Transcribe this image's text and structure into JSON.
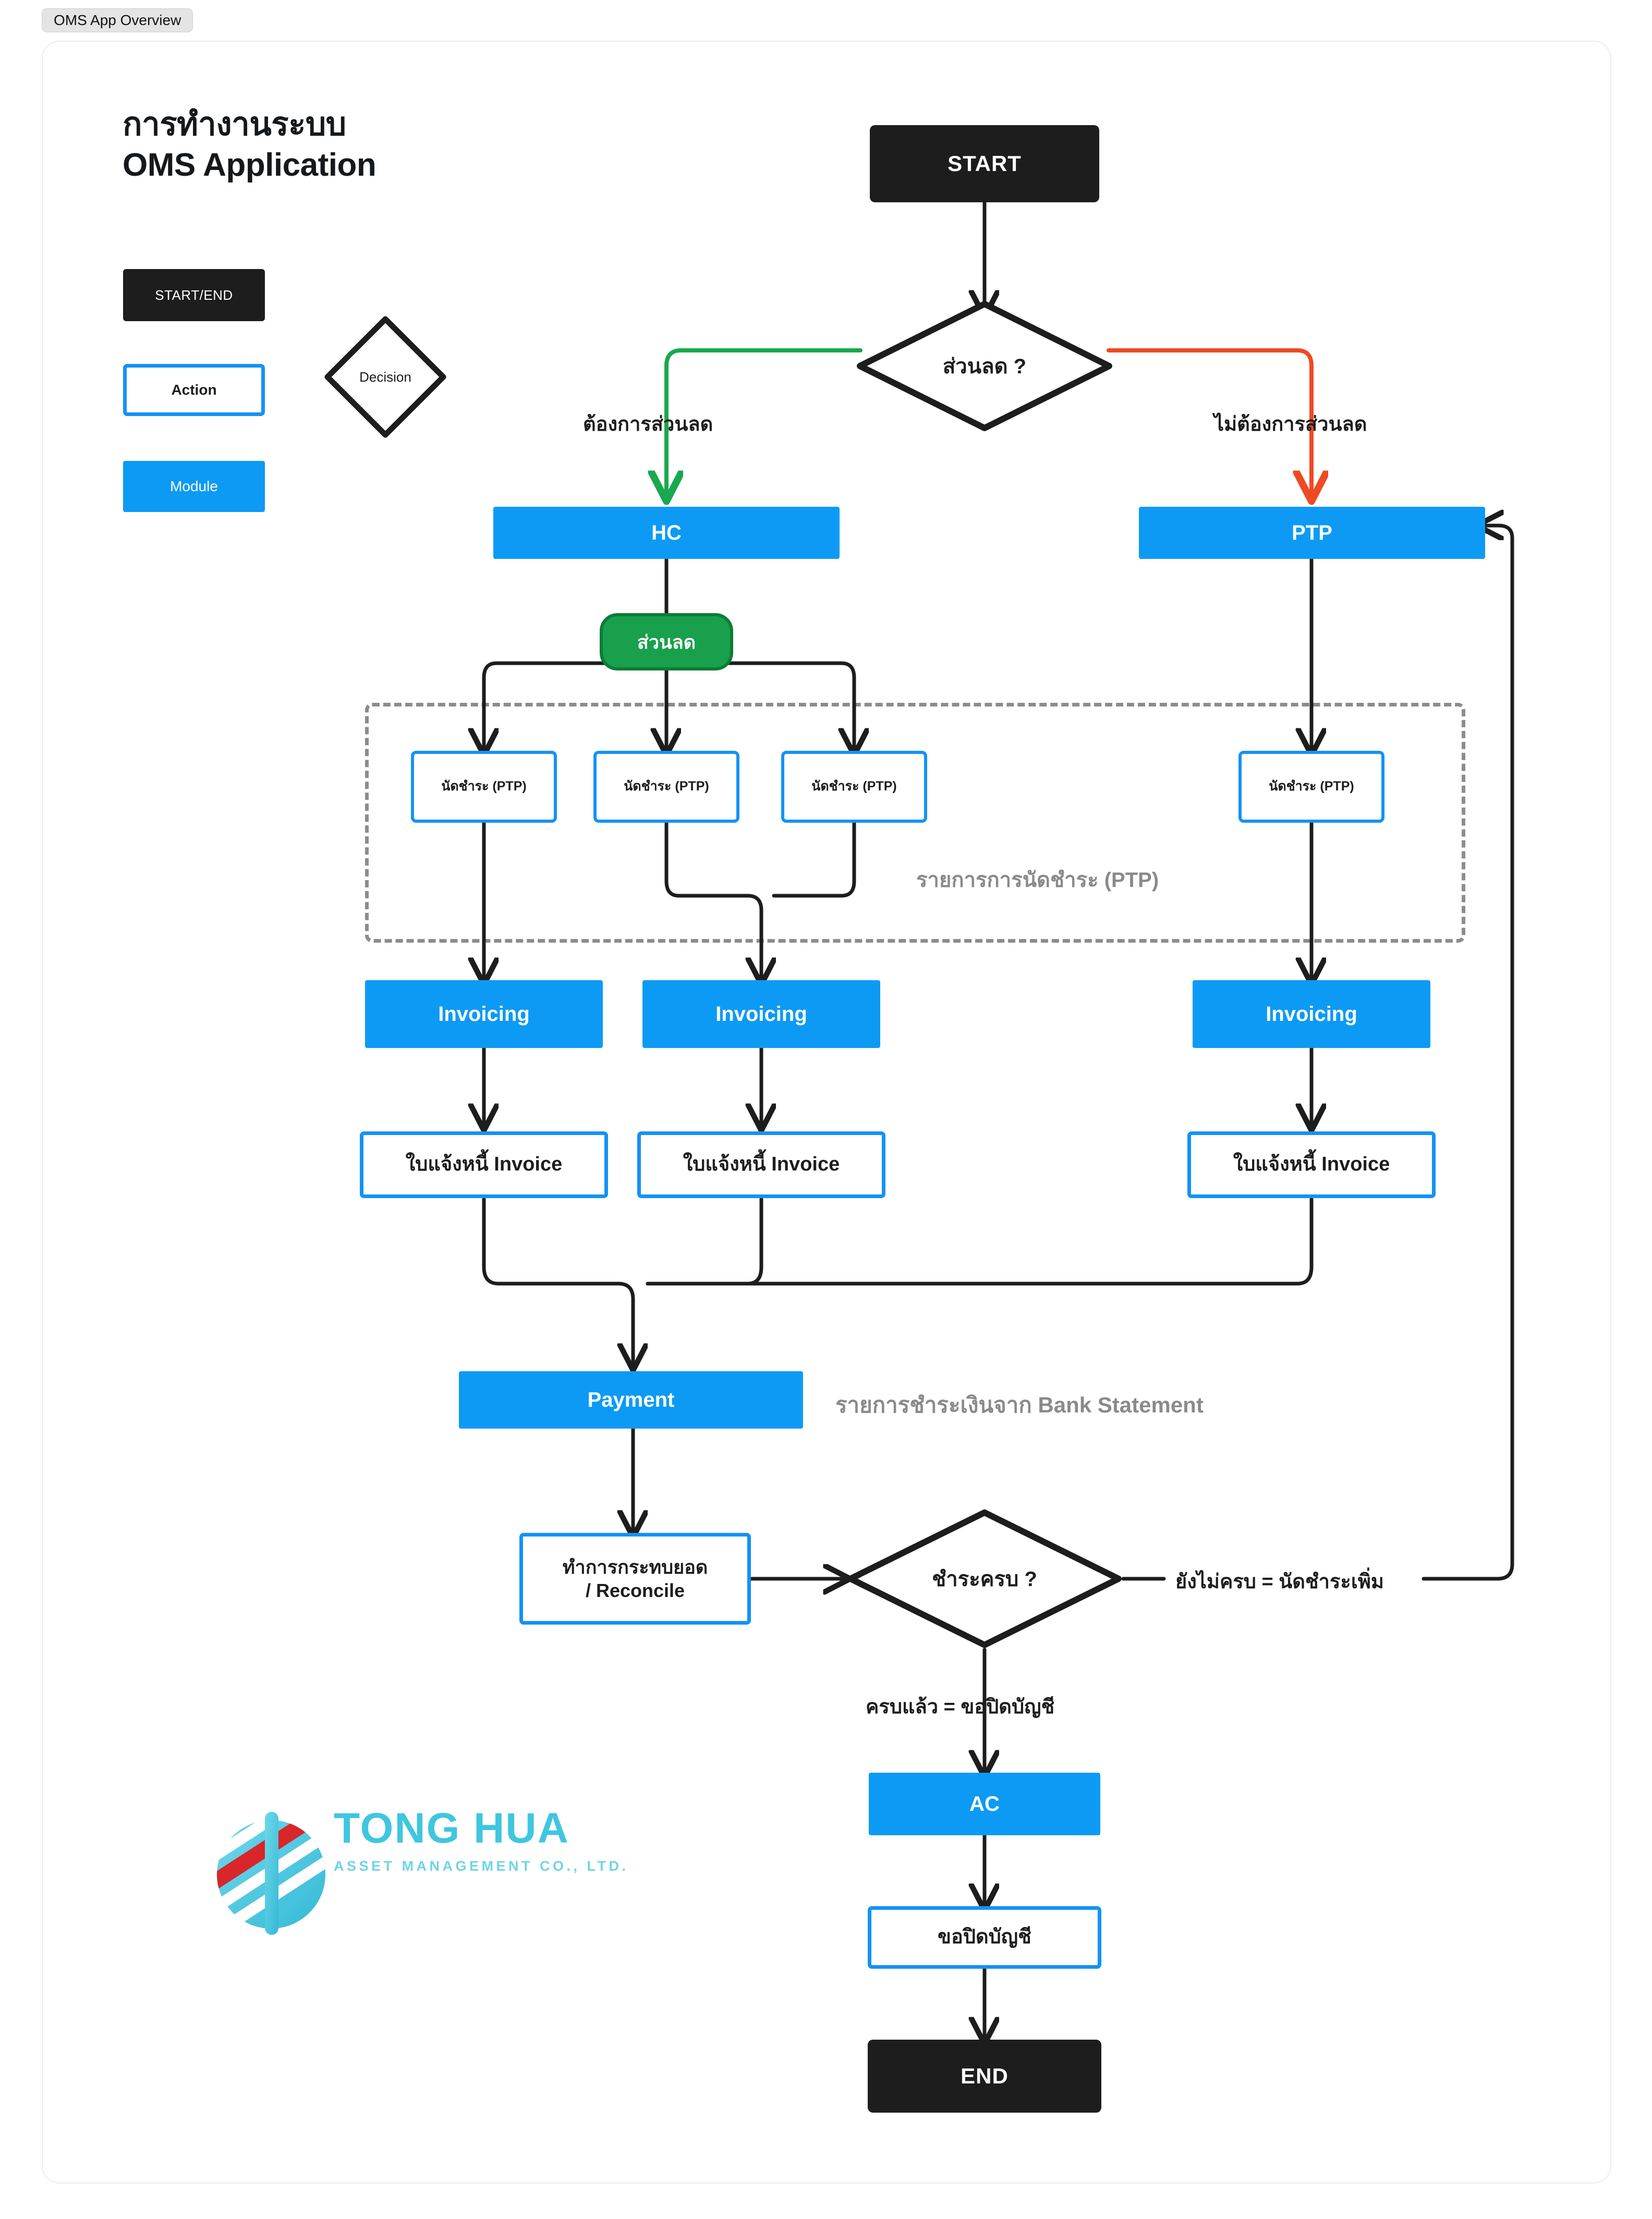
{
  "browser": {
    "tab_label": "OMS App Overview"
  },
  "header": {
    "title_line1": "การทำงานระบบ",
    "title_line2": "OMS Application"
  },
  "legend": {
    "start_end": "START/END",
    "action": "Action",
    "module": "Module",
    "decision": "Decision"
  },
  "nodes": {
    "start": "START",
    "decision_discount": "ส่วนลด ?",
    "hc": "HC",
    "ptp": "PTP",
    "discount_pill": "ส่วนลด",
    "ptp_item_1": "นัดชำระ (PTP)",
    "ptp_item_2": "นัดชำระ (PTP)",
    "ptp_item_3": "นัดชำระ (PTP)",
    "ptp_item_4": "นัดชำระ (PTP)",
    "invoicing_1": "Invoicing",
    "invoicing_2": "Invoicing",
    "invoicing_3": "Invoicing",
    "invoice_doc_1": "ใบแจ้งหนี้ Invoice",
    "invoice_doc_2": "ใบแจ้งหนี้ Invoice",
    "invoice_doc_3": "ใบแจ้งหนี้ Invoice",
    "payment": "Payment",
    "reconcile_line1": "ทำการกระทบยอด",
    "reconcile_line2": "/ Reconcile",
    "decision_paid": "ชำระครบ ?",
    "ac": "AC",
    "close_account": "ขอปิดบัญชี",
    "end": "END"
  },
  "edge_labels": {
    "want_discount": "ต้องการส่วนลด",
    "no_discount": "ไม่ต้องการส่วนลด",
    "not_complete": "ยังไม่ครบ = นัดชำระเพิ่ม",
    "complete": "ครบแล้ว =  ขอปิดบัญชี"
  },
  "group_labels": {
    "ptp_list": "รายการการนัดชำระ (PTP)",
    "bank_statement": "รายการชำระเงินจาก Bank Statement"
  },
  "logo": {
    "name": "TONG HUA",
    "subtitle": "ASSET MANAGEMENT CO., LTD."
  },
  "colors": {
    "module_blue": "#0d9af5",
    "action_border_blue": "#1492f7",
    "terminal_black": "#1d1d1d",
    "pill_green": "#18a04c",
    "branch_green": "#1aa84f",
    "branch_red": "#ee4a24",
    "muted_grey": "#8a8a8a",
    "dashed_grey": "#8c8c8c",
    "logo_cyan": "#3fc6e0",
    "logo_red": "#d8262a"
  }
}
